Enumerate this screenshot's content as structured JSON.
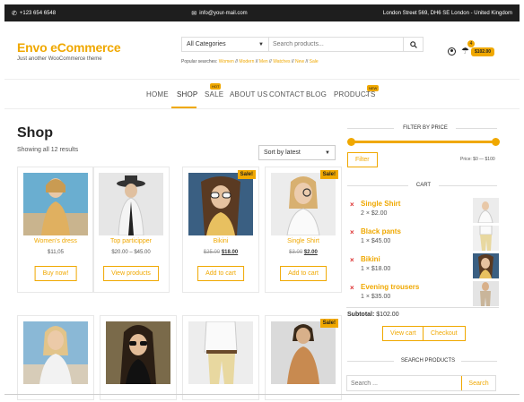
{
  "topbar": {
    "phone": "+123 654 6548",
    "email": "info@your-mail.com",
    "address": "London Street 569, DH6 SE London - United Kingdom"
  },
  "brand": {
    "name": "Envo eCommerce",
    "tagline": "Just another WooCommerce theme"
  },
  "search": {
    "category": "All Categories",
    "placeholder": "Search products...",
    "popular_label": "Popular searches:",
    "popular": [
      "Women",
      "Modern",
      "Men",
      "Watches",
      "New",
      "Sale"
    ]
  },
  "cart_header": {
    "count": "4",
    "total": "$102.00"
  },
  "nav": {
    "items": [
      {
        "label": "HOME"
      },
      {
        "label": "SHOP"
      },
      {
        "label": "SALE",
        "badge": "HOT"
      },
      {
        "label": "ABOUT US"
      },
      {
        "label": "CONTACT"
      },
      {
        "label": "BLOG"
      },
      {
        "label": "PRODUCTS",
        "badge": "NEW"
      }
    ],
    "active": "SHOP"
  },
  "shop": {
    "title": "Shop",
    "results": "Showing all 12 results",
    "sort": "Sort by latest"
  },
  "products": [
    {
      "name": "Women's dress",
      "price": "$11,05",
      "action": "Buy now!",
      "sale": false
    },
    {
      "name": "Top participper",
      "price": "$20.00 – $45.00",
      "action": "View products",
      "sale": false
    },
    {
      "name": "Bikini",
      "price_old": "$25.00",
      "price_new": "$18.00",
      "action": "Add to cart",
      "sale": true
    },
    {
      "name": "Single Shirt",
      "price_old": "$3.00",
      "price_new": "$2.00",
      "action": "Add to cart",
      "sale": true
    },
    {
      "name": "",
      "sale": false
    },
    {
      "name": "",
      "sale": false
    },
    {
      "name": "",
      "sale": false
    },
    {
      "name": "",
      "sale": true
    }
  ],
  "sale_label": "Sale!",
  "sidebar": {
    "filter_title": "FILTER BY PRICE",
    "filter_button": "Filter",
    "price_range": "Price: $0 — $100",
    "cart_title": "CART",
    "cart_items": [
      {
        "name": "Single Shirt",
        "qty": "2 × $2.00"
      },
      {
        "name": "Black pants",
        "qty": "1 × $45.00"
      },
      {
        "name": "Bikini",
        "qty": "1 × $18.00"
      },
      {
        "name": "Evening trousers",
        "qty": "1 × $35.00"
      }
    ],
    "subtotal_label": "Subtotal:",
    "subtotal_value": "$102.00",
    "view_cart": "View cart",
    "checkout": "Checkout",
    "search_title": "SEARCH PRODUCTS",
    "search_placeholder": "Search ...",
    "search_button": "Search"
  },
  "colors": {
    "accent": "#f0a800",
    "topbar": "#1e1e1e",
    "remove": "#dd3333"
  }
}
